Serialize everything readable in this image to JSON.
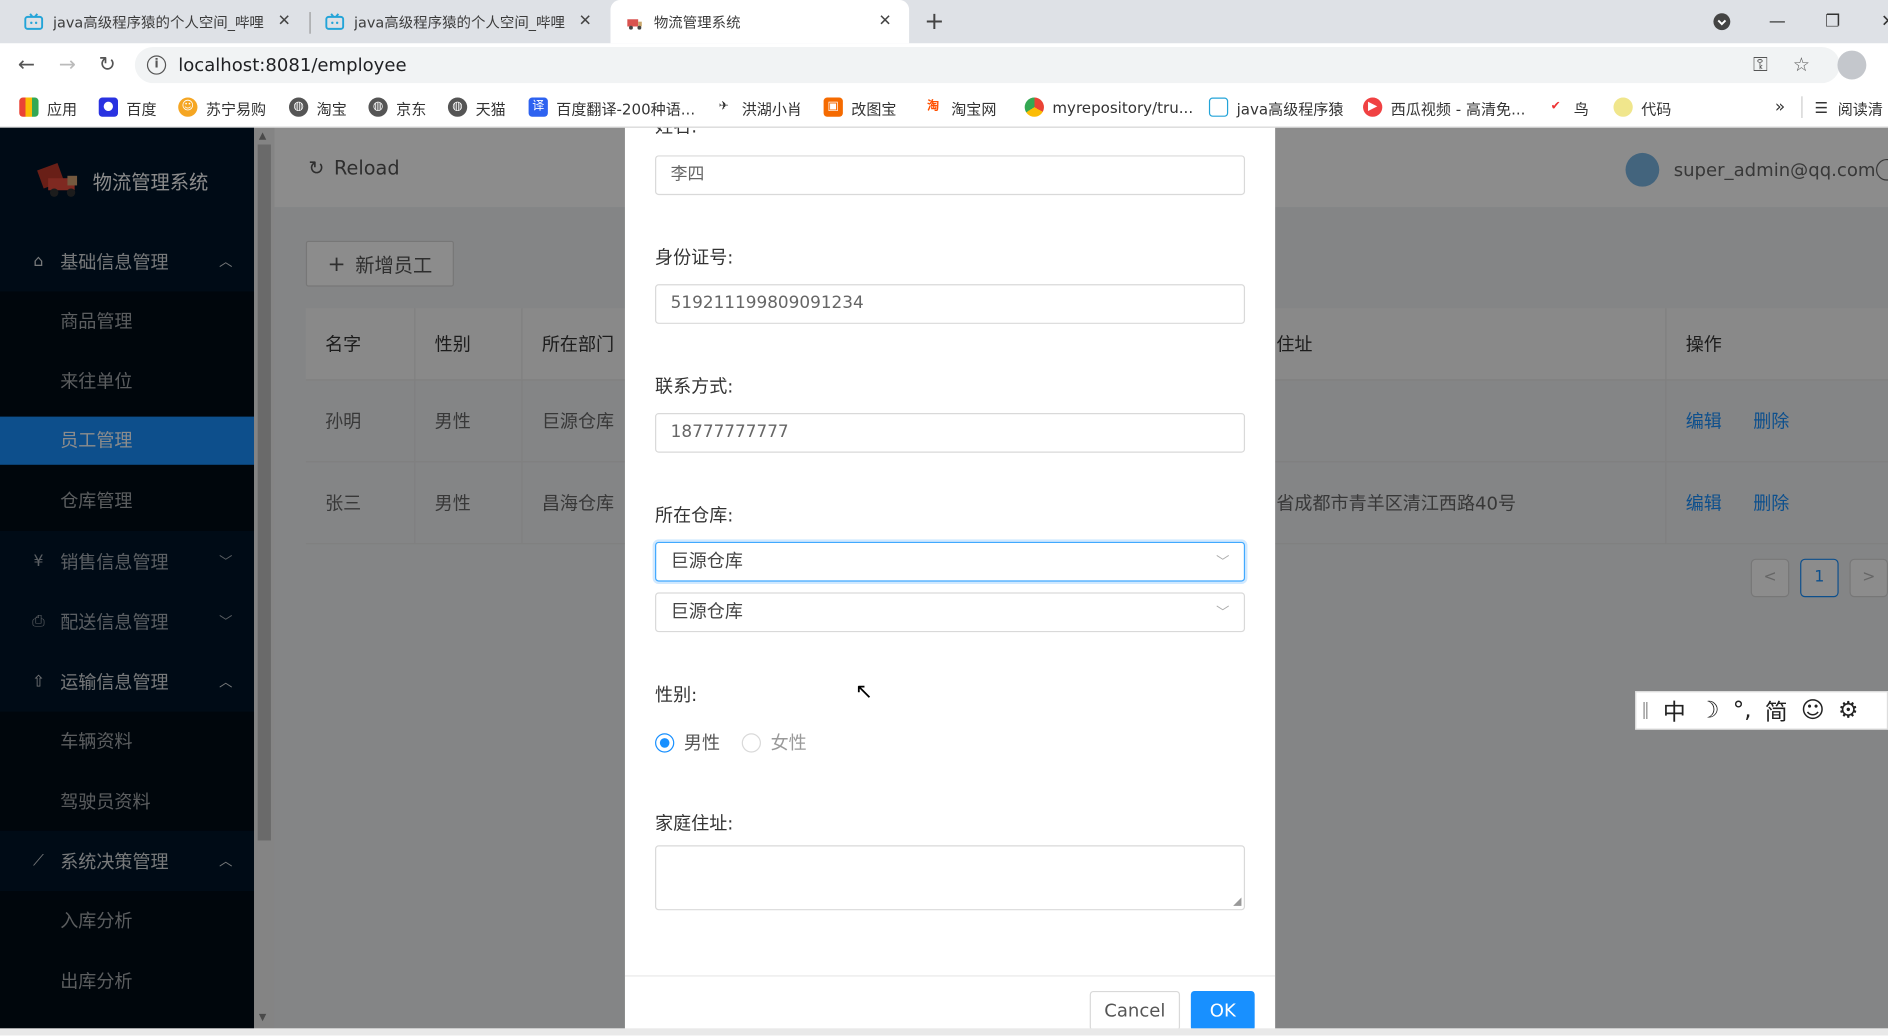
{
  "browser": {
    "tabs": [
      {
        "title": "java高级程序猿的个人空间_哔哩",
        "active": false
      },
      {
        "title": "java高级程序猿的个人空间_哔哩",
        "active": false
      },
      {
        "title": "物流管理系统",
        "active": true
      }
    ],
    "url": "localhost:8081/employee",
    "bookmarks": [
      {
        "label": "应用",
        "icon": "apps-grid-icon"
      },
      {
        "label": "百度",
        "icon": "baidu-paw-icon"
      },
      {
        "label": "苏宁易购",
        "icon": "suning-icon"
      },
      {
        "label": "淘宝",
        "icon": "globe-icon"
      },
      {
        "label": "京东",
        "icon": "globe-icon"
      },
      {
        "label": "天猫",
        "icon": "globe-icon"
      },
      {
        "label": "百度翻译-200种语...",
        "icon": "translate-icon"
      },
      {
        "label": "洪湖小肖",
        "icon": "bird-icon"
      },
      {
        "label": "改图宝",
        "icon": "image-icon"
      },
      {
        "label": "淘宝网",
        "icon": "taobao-icon"
      },
      {
        "label": "myrepository/tru...",
        "icon": "chrome-icon"
      },
      {
        "label": "java高级程序猿",
        "icon": "bilibili-icon"
      },
      {
        "label": "西瓜视频 - 高清免...",
        "icon": "xigua-icon"
      },
      {
        "label": "鸟",
        "icon": "bird-red-icon"
      },
      {
        "label": "代码",
        "icon": "code-icon"
      }
    ],
    "bookmarks_overflow": "»",
    "reading_list": "阅读清"
  },
  "app": {
    "title": "物流管理系统",
    "reload_label": "Reload",
    "user_email": "super_admin@qq.com",
    "sidebar": {
      "groups": [
        {
          "label": "基础信息管理",
          "icon": "home-icon",
          "expanded": true
        },
        {
          "label": "销售信息管理",
          "icon": "yen-icon",
          "expanded": false
        },
        {
          "label": "配送信息管理",
          "icon": "printer-icon",
          "expanded": false
        },
        {
          "label": "运输信息管理",
          "icon": "rocket-icon",
          "expanded": true
        },
        {
          "label": "系统决策管理",
          "icon": "line-chart-icon",
          "expanded": true
        }
      ],
      "items": [
        "商品管理",
        "来往单位",
        "员工管理",
        "仓库管理",
        "车辆资料",
        "驾驶员资料",
        "入库分析",
        "出库分析"
      ],
      "selected": "员工管理"
    },
    "add_button": "新增员工",
    "table": {
      "headers": [
        "名字",
        "性别",
        "所在部门",
        "住址",
        "操作"
      ],
      "rows": [
        {
          "name": "孙明",
          "gender": "男性",
          "dept": "巨源仓库",
          "address": "",
          "actions": [
            "编辑",
            "删除"
          ]
        },
        {
          "name": "张三",
          "gender": "男性",
          "dept": "昌海仓库",
          "address": "省成都市青羊区清江西路40号",
          "actions": [
            "编辑",
            "删除"
          ]
        }
      ]
    },
    "pagination": {
      "prev": "<",
      "current": "1",
      "next": ">"
    }
  },
  "modal": {
    "name_label": "姓名:",
    "name_value": "李四",
    "id_label": "身份证号:",
    "id_value": "519211199809091234",
    "phone_label": "联系方式:",
    "phone_value": "18777777777",
    "warehouse_label": "所在仓库:",
    "warehouse_value": "巨源仓库",
    "warehouse_option": "巨源仓库",
    "gender_label": "性别:",
    "gender_options": [
      "男性",
      "女性"
    ],
    "gender_selected": "男性",
    "address_label": "家庭住址:",
    "address_value": "",
    "cancel_label": "Cancel",
    "ok_label": "OK"
  },
  "ime": {
    "items": [
      "中",
      "☽",
      "°,",
      "简",
      "☺",
      "⚙"
    ]
  },
  "colors": {
    "primary": "#1890ff",
    "sider": "#001529",
    "submenu": "#000c17"
  }
}
